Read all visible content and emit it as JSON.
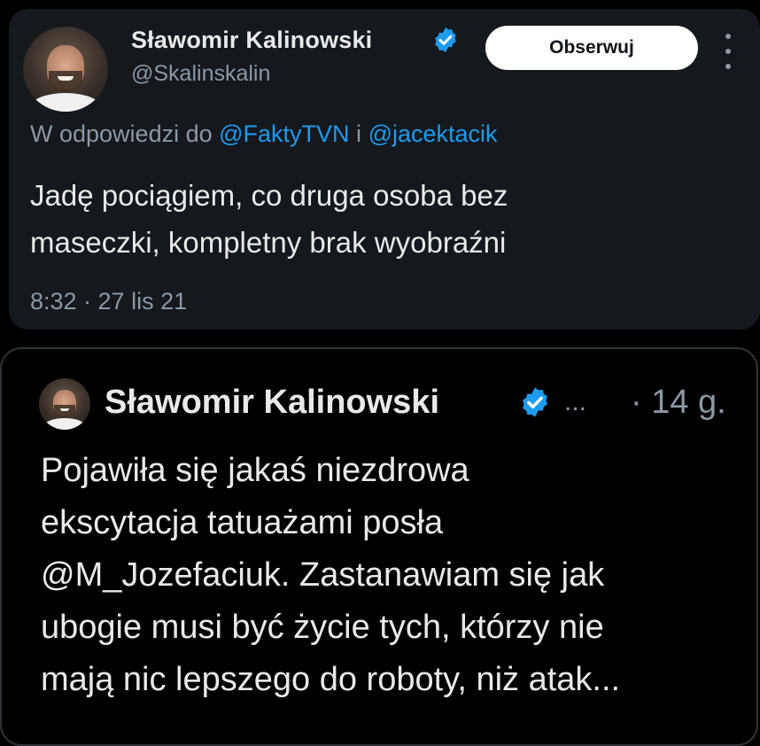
{
  "main_tweet": {
    "author_name": "Sławomir Kalinowski",
    "author_handle": "@Skalinskalin",
    "follow_label": "Obserwuj",
    "reply_prefix": "W odpowiedzi do ",
    "reply_mention_1": "@FaktyTVN",
    "reply_joiner": " i ",
    "reply_mention_2": "@jacektacik",
    "text_line_1": "Jadę pociągiem, co druga osoba bez",
    "text_line_2": "maseczki, kompletny brak wyobraźni",
    "timestamp": "8:32 · 27 lis 21"
  },
  "quoted_tweet": {
    "author_name": "Sławomir Kalinowski",
    "ellipsis": "...",
    "age": "· 14 g.",
    "lines": [
      "Pojawiła się jakaś niezdrowa",
      "ekscytacja tatuażami posła",
      "@M_Jozefaciuk. Zastanawiam się jak",
      "ubogie musi być życie tych, którzy nie",
      "mają nic lepszego do roboty, niż atak..."
    ]
  },
  "colors": {
    "background": "#000000",
    "card_background": "#15181c",
    "text_primary": "#e7e9ea",
    "text_secondary": "#8b98a5",
    "accent_blue": "#1d9bf0",
    "button_bg": "#ffffff",
    "border": "#2f3336"
  },
  "icons": {
    "verified": "verified-badge-icon",
    "more": "more-vertical-icon"
  }
}
